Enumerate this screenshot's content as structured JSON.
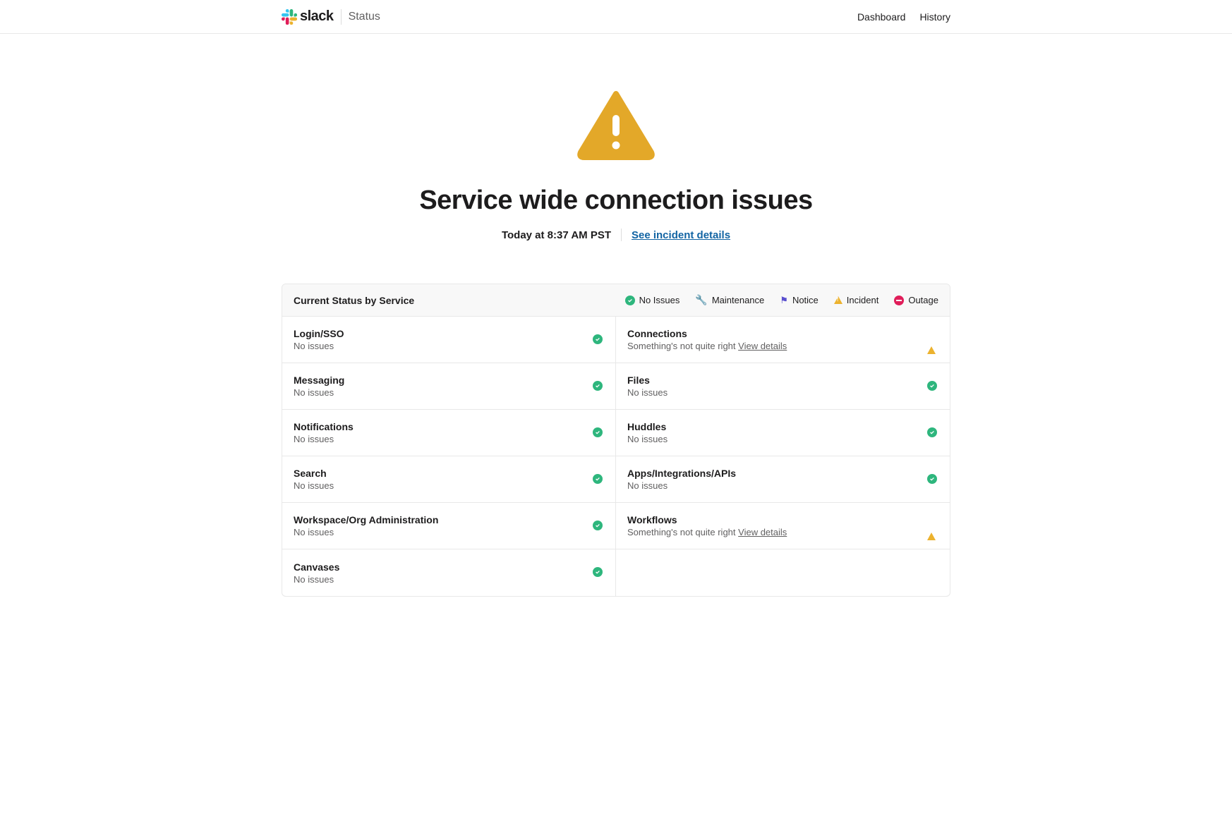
{
  "header": {
    "brand": "slack",
    "section": "Status",
    "nav": [
      {
        "label": "Dashboard"
      },
      {
        "label": "History"
      }
    ]
  },
  "hero": {
    "title": "Service wide connection issues",
    "time": "Today at 8:37 AM PST",
    "link_label": "See incident details"
  },
  "table": {
    "header_title": "Current Status by Service",
    "legend": {
      "no_issues": "No Issues",
      "maintenance": "Maintenance",
      "notice": "Notice",
      "incident": "Incident",
      "outage": "Outage"
    }
  },
  "statuses": {
    "no_issues": "No issues",
    "not_right": "Something's not quite right",
    "view_details": "View details"
  },
  "services": [
    {
      "name": "Login/SSO",
      "status": "ok"
    },
    {
      "name": "Connections",
      "status": "incident"
    },
    {
      "name": "Messaging",
      "status": "ok"
    },
    {
      "name": "Files",
      "status": "ok"
    },
    {
      "name": "Notifications",
      "status": "ok"
    },
    {
      "name": "Huddles",
      "status": "ok"
    },
    {
      "name": "Search",
      "status": "ok"
    },
    {
      "name": "Apps/Integrations/APIs",
      "status": "ok"
    },
    {
      "name": "Workspace/Org Administration",
      "status": "ok"
    },
    {
      "name": "Workflows",
      "status": "incident"
    },
    {
      "name": "Canvases",
      "status": "ok"
    }
  ]
}
